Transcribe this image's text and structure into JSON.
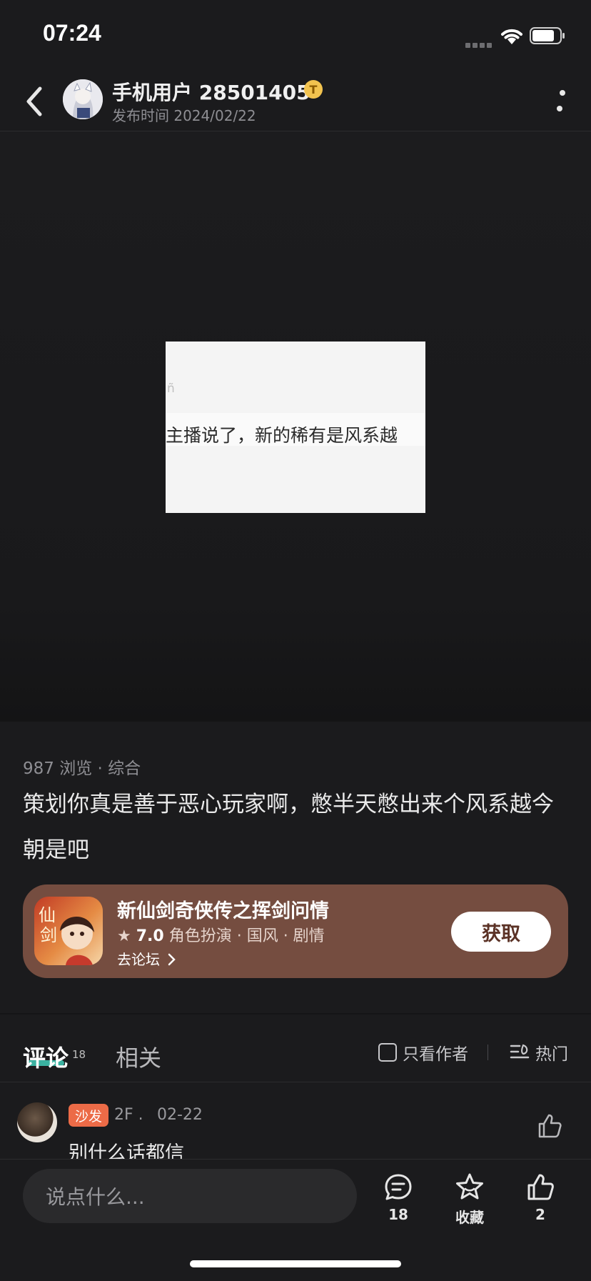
{
  "status_bar": {
    "time": "07:24"
  },
  "header": {
    "author_name": "手机用户 28501405",
    "author_badge": "T",
    "publish_time": "发布时间 2024/02/22"
  },
  "media": {
    "hint_text": "ñ",
    "caption": "主播说了，新的稀有是风系越"
  },
  "post": {
    "meta": "987 浏览 · 综合",
    "text": "策划你真是善于恶心玩家啊，憋半天憋出来个风系越今朝是吧"
  },
  "game_card": {
    "title": "新仙剑奇侠传之挥剑问情",
    "star": "★",
    "rating": "7.0",
    "tags": "角色扮演 · 国风 · 剧情",
    "forum_link": "去论坛",
    "get_label": "获取",
    "icon_name": "game-app-icon",
    "background_color": "#754d40"
  },
  "tabs": {
    "comments_label": "评论",
    "comments_count": "18",
    "related_label": "相关",
    "only_author_label": "只看作者",
    "sort_label": "热门"
  },
  "comments": [
    {
      "badge": "沙发",
      "floor": "2F .",
      "date": "02-22",
      "text": "别什么话都信"
    }
  ],
  "bottom_bar": {
    "input_placeholder": "说点什么...",
    "comment_count": "18",
    "favorite_label": "收藏",
    "like_count": "2"
  },
  "colors": {
    "background": "#1b1b1d",
    "accent_tab": "#3fc3b0",
    "sofa_badge": "#ec6b47",
    "author_badge": "#f2c34f"
  }
}
